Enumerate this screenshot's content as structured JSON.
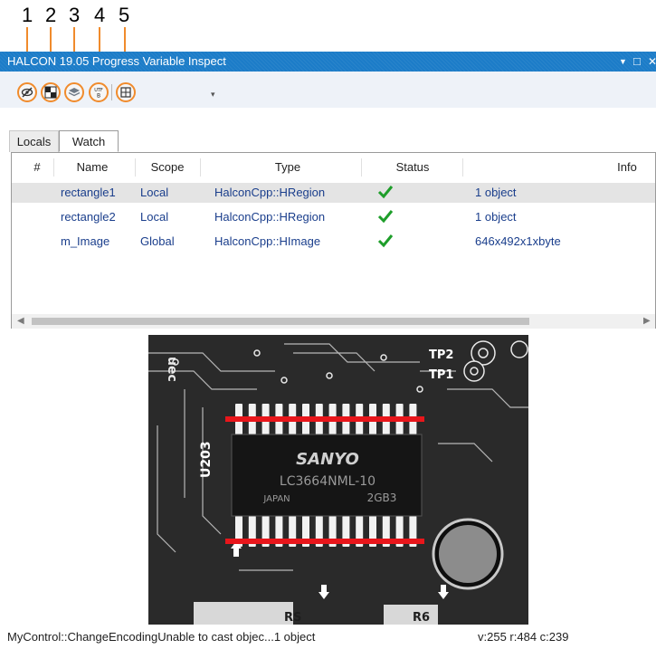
{
  "callouts": [
    "1",
    "2",
    "3",
    "4",
    "5"
  ],
  "window": {
    "title": "HALCON 19.05 Progress Variable Inspect",
    "controls": {
      "dropdown": "▼",
      "maximize": "□",
      "close": "✕"
    }
  },
  "toolbar": {
    "buttons": [
      {
        "icon": "eye-slash-icon"
      },
      {
        "icon": "checkerboard-icon"
      },
      {
        "icon": "stack-icon"
      },
      {
        "icon": "utf8-encoding-icon",
        "text": "UTF\nB"
      },
      {
        "icon": "grid-icon"
      }
    ],
    "overflow_glyph": "▾"
  },
  "tabs": [
    "Locals",
    "Watch"
  ],
  "active_tab": "Watch",
  "table": {
    "columns": [
      "#",
      "Name",
      "Scope",
      "Type",
      "Status",
      "Info"
    ],
    "rows": [
      {
        "name": "rectangle1",
        "scope": "Local",
        "type": "HalconCpp::HRegion",
        "status": "ok",
        "info": "1 object",
        "selected": true
      },
      {
        "name": "rectangle2",
        "scope": "Local",
        "type": "HalconCpp::HRegion",
        "status": "ok",
        "info": "1 object",
        "selected": false
      },
      {
        "name": "m_Image",
        "scope": "Global",
        "type": "HalconCpp::HImage",
        "status": "ok",
        "info": "646x492x1xbyte",
        "selected": false
      }
    ]
  },
  "image": {
    "chip_brand": "SANYO",
    "chip_part": "LC3664NML-10",
    "chip_origin": "JAPAN",
    "chip_code": "2GB3",
    "pcb_ref": "U203",
    "pcb_tp1": "TP1",
    "pcb_tp2": "TP2",
    "pcb_top_left": "uec",
    "pcb_bottom_a": "RS",
    "pcb_bottom_b": "R6"
  },
  "colors": {
    "accent": "#f08b2c",
    "titlebar": "#1c7cc8",
    "region": "#e8161b",
    "ok": "#1e9e2a"
  },
  "status": {
    "message": "MyControl::ChangeEncodingUnable to cast objec...1 object",
    "pixel_info": "v:255 r:484 c:239"
  }
}
